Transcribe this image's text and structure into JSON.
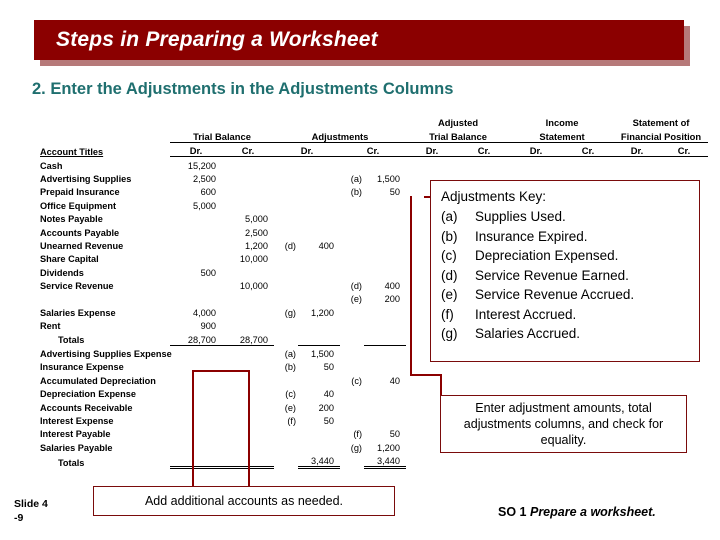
{
  "title": "Steps in Preparing a Worksheet",
  "subtitle": "2. Enter the Adjustments in the Adjustments Columns",
  "worksheet": {
    "group_headers": [
      {
        "label": "Trial Balance"
      },
      {
        "label": "Adjustments"
      },
      {
        "label": "Adjusted"
      },
      {
        "label": "Trial Balance"
      },
      {
        "label": "Income"
      },
      {
        "label": "Statement"
      },
      {
        "label": "Statement of"
      },
      {
        "label": "Financial Position"
      }
    ],
    "account_titles_header": "Account Titles",
    "column_headers": [
      "Dr.",
      "Cr.",
      "Dr.",
      "Cr.",
      "Dr.",
      "Cr.",
      "Dr.",
      "Cr.",
      "Dr.",
      "Cr."
    ],
    "rows": [
      {
        "title": "Cash",
        "tb_dr": "15,200",
        "tb_cr": "",
        "adj_tag_dr": "",
        "adj_dr": "",
        "adj_tag_cr": "",
        "adj_cr": ""
      },
      {
        "title": "Advertising Supplies",
        "tb_dr": "2,500",
        "tb_cr": "",
        "adj_tag_dr": "",
        "adj_dr": "",
        "adj_tag_cr": "(a)",
        "adj_cr": "1,500"
      },
      {
        "title": "Prepaid Insurance",
        "tb_dr": "600",
        "tb_cr": "",
        "adj_tag_dr": "",
        "adj_dr": "",
        "adj_tag_cr": "(b)",
        "adj_cr": "50"
      },
      {
        "title": "Office Equipment",
        "tb_dr": "5,000",
        "tb_cr": "",
        "adj_tag_dr": "",
        "adj_dr": "",
        "adj_tag_cr": "",
        "adj_cr": ""
      },
      {
        "title": "Notes Payable",
        "tb_dr": "",
        "tb_cr": "5,000",
        "adj_tag_dr": "",
        "adj_dr": "",
        "adj_tag_cr": "",
        "adj_cr": ""
      },
      {
        "title": "Accounts Payable",
        "tb_dr": "",
        "tb_cr": "2,500",
        "adj_tag_dr": "",
        "adj_dr": "",
        "adj_tag_cr": "",
        "adj_cr": ""
      },
      {
        "title": "Unearned Revenue",
        "tb_dr": "",
        "tb_cr": "1,200",
        "adj_tag_dr": "(d)",
        "adj_dr": "400",
        "adj_tag_cr": "",
        "adj_cr": ""
      },
      {
        "title": "Share Capital",
        "tb_dr": "",
        "tb_cr": "10,000",
        "adj_tag_dr": "",
        "adj_dr": "",
        "adj_tag_cr": "",
        "adj_cr": ""
      },
      {
        "title": "Dividends",
        "tb_dr": "500",
        "tb_cr": "",
        "adj_tag_dr": "",
        "adj_dr": "",
        "adj_tag_cr": "",
        "adj_cr": ""
      },
      {
        "title": "Service Revenue",
        "tb_dr": "",
        "tb_cr": "10,000",
        "adj_tag_dr": "",
        "adj_dr": "",
        "adj_tag_cr": "(d)",
        "adj_cr": "400"
      },
      {
        "title": "",
        "tb_dr": "",
        "tb_cr": "",
        "adj_tag_dr": "",
        "adj_dr": "",
        "adj_tag_cr": "(e)",
        "adj_cr": "200"
      },
      {
        "title": "Salaries Expense",
        "tb_dr": "4,000",
        "tb_cr": "",
        "adj_tag_dr": "(g)",
        "adj_dr": "1,200",
        "adj_tag_cr": "",
        "adj_cr": ""
      },
      {
        "title": "Rent",
        "tb_dr": "900",
        "tb_cr": "",
        "adj_tag_dr": "",
        "adj_dr": "",
        "adj_tag_cr": "",
        "adj_cr": ""
      },
      {
        "title": "Totals",
        "tb_dr": "28,700",
        "tb_cr": "28,700",
        "adj_tag_dr": "",
        "adj_dr": "",
        "adj_tag_cr": "",
        "adj_cr": "",
        "indent": true,
        "rule": true
      },
      {
        "title": "Advertising Supplies Expense",
        "tb_dr": "",
        "tb_cr": "",
        "adj_tag_dr": "(a)",
        "adj_dr": "1,500",
        "adj_tag_cr": "",
        "adj_cr": ""
      },
      {
        "title": "Insurance Expense",
        "tb_dr": "",
        "tb_cr": "",
        "adj_tag_dr": "(b)",
        "adj_dr": "50",
        "adj_tag_cr": "",
        "adj_cr": ""
      },
      {
        "title": "Accumulated Depreciation",
        "tb_dr": "",
        "tb_cr": "",
        "adj_tag_dr": "",
        "adj_dr": "",
        "adj_tag_cr": "(c)",
        "adj_cr": "40"
      },
      {
        "title": "Depreciation Expense",
        "tb_dr": "",
        "tb_cr": "",
        "adj_tag_dr": "(c)",
        "adj_dr": "40",
        "adj_tag_cr": "",
        "adj_cr": ""
      },
      {
        "title": "Accounts Receivable",
        "tb_dr": "",
        "tb_cr": "",
        "adj_tag_dr": "(e)",
        "adj_dr": "200",
        "adj_tag_cr": "",
        "adj_cr": ""
      },
      {
        "title": "Interest Expense",
        "tb_dr": "",
        "tb_cr": "",
        "adj_tag_dr": "(f)",
        "adj_dr": "50",
        "adj_tag_cr": "",
        "adj_cr": ""
      },
      {
        "title": "Interest Payable",
        "tb_dr": "",
        "tb_cr": "",
        "adj_tag_dr": "",
        "adj_dr": "",
        "adj_tag_cr": "(f)",
        "adj_cr": "50"
      },
      {
        "title": "Salaries Payable",
        "tb_dr": "",
        "tb_cr": "",
        "adj_tag_dr": "",
        "adj_dr": "",
        "adj_tag_cr": "(g)",
        "adj_cr": "1,200"
      },
      {
        "title": "Totals",
        "tb_dr": "",
        "tb_cr": "",
        "adj_tag_dr": "",
        "adj_dr": "3,440",
        "adj_tag_cr": "",
        "adj_cr": "3,440",
        "indent": true,
        "double": true
      }
    ]
  },
  "adjustments_key": {
    "title": "Adjustments Key:",
    "items": [
      {
        "label": "(a)",
        "text": "Supplies Used."
      },
      {
        "label": "(b)",
        "text": "Insurance Expired."
      },
      {
        "label": "(c)",
        "text": "Depreciation Expensed."
      },
      {
        "label": "(d)",
        "text": "Service Revenue Earned."
      },
      {
        "label": "(e)",
        "text": "Service Revenue Accrued."
      },
      {
        "label": "(f)",
        "text": "Interest Accrued."
      },
      {
        "label": "(g)",
        "text": "Salaries Accrued."
      }
    ]
  },
  "note_box": "Enter adjustment amounts, total adjustments columns, and check for equality.",
  "add_box": "Add additional accounts as needed.",
  "footer": {
    "slide_label": "Slide 4",
    "slide_sub": "-9",
    "so_label": "SO 1",
    "so_text": "Prepare a worksheet."
  }
}
